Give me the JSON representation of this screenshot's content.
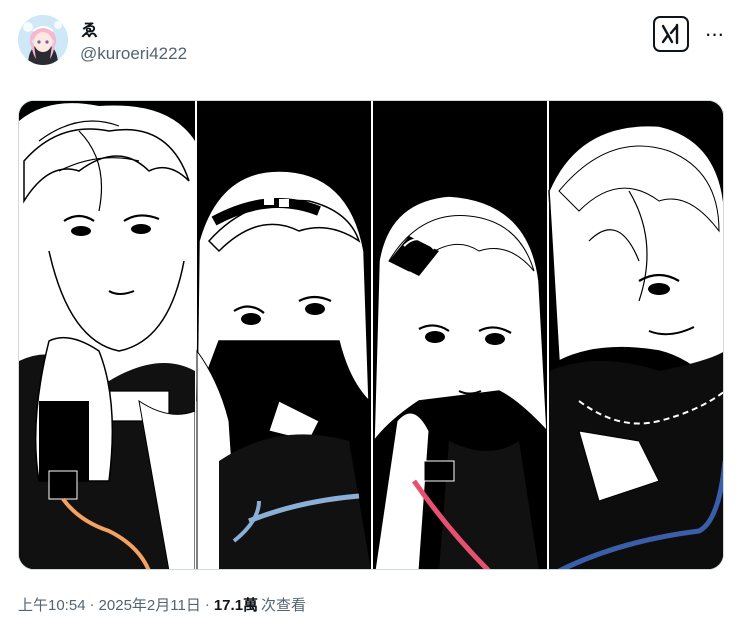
{
  "author": {
    "display_name": "ゑ",
    "handle": "@kuroeri4222"
  },
  "header": {
    "grok_icon": "grok-icon",
    "more_icon": "more-options-icon",
    "more_label": "···"
  },
  "media": {
    "panels": [
      {
        "id": "panel-1",
        "accent_color": "#f4a261"
      },
      {
        "id": "panel-2",
        "accent_color": "#8ab0d8"
      },
      {
        "id": "panel-3",
        "accent_color": "#e8506f"
      },
      {
        "id": "panel-4",
        "accent_color": "#3a5fa8"
      }
    ]
  },
  "meta": {
    "time": "上午10:54",
    "separator": "·",
    "date": "2025年2月11日",
    "views_count": "17.1萬",
    "views_label": "次查看"
  },
  "colors": {
    "text_primary": "#0f1419",
    "text_secondary": "#536471",
    "border": "#cfd9de"
  }
}
